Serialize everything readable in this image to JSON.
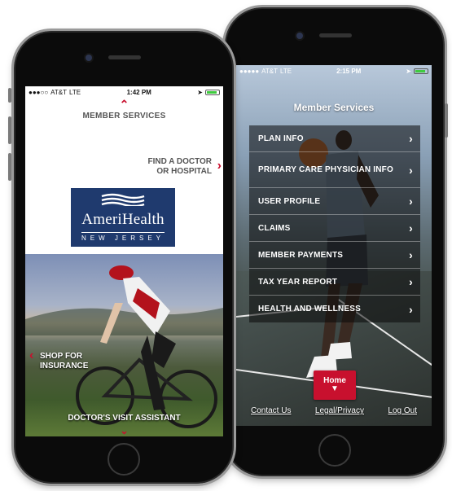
{
  "left_phone": {
    "status": {
      "carrier": "AT&T",
      "network": "LTE",
      "time": "1:42 PM"
    },
    "header": {
      "title": "MEMBER SERVICES"
    },
    "find_doctor": {
      "line1": "FIND A DOCTOR",
      "line2": "OR HOSPITAL"
    },
    "logo": {
      "brand": "AmeriHealth",
      "sub": "NEW JERSEY"
    },
    "shop": {
      "line1": "SHOP FOR",
      "line2": "INSURANCE"
    },
    "assistant": {
      "label": "DOCTOR'S VISIT ASSISTANT"
    }
  },
  "right_phone": {
    "status": {
      "carrier": "AT&T",
      "network": "LTE",
      "time": "2:15 PM"
    },
    "title": "Member Services",
    "menu": [
      {
        "label": "PLAN INFO"
      },
      {
        "label": "PRIMARY CARE PHYSICIAN INFO"
      },
      {
        "label": "USER PROFILE"
      },
      {
        "label": "CLAIMS"
      },
      {
        "label": "MEMBER PAYMENTS"
      },
      {
        "label": "TAX YEAR REPORT"
      },
      {
        "label": "HEALTH AND WELLNESS"
      }
    ],
    "home_label": "Home",
    "footer": {
      "contact": "Contact Us",
      "legal": "Legal/Privacy",
      "logout": "Log Out"
    }
  },
  "colors": {
    "accent_red": "#c8102e",
    "brand_navy": "#1f3a6e"
  }
}
